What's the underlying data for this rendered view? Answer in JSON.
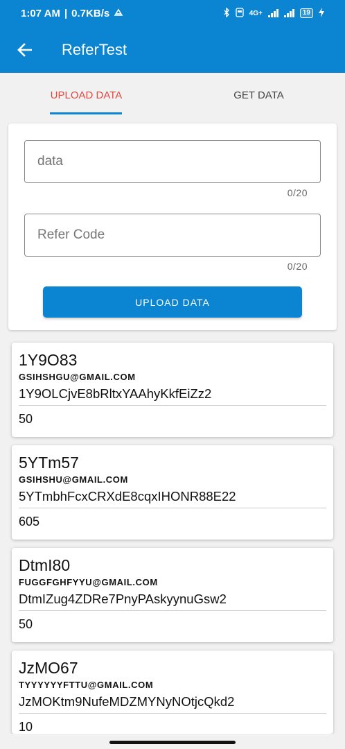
{
  "status_bar": {
    "time": "1:07 AM",
    "separator": "|",
    "speed": "0.7KB/s",
    "network": "4G+",
    "battery": "19"
  },
  "app_bar": {
    "title": "ReferTest"
  },
  "tabs": [
    {
      "label": "UPLOAD DATA",
      "active": true
    },
    {
      "label": "GET DATA",
      "active": false
    }
  ],
  "form": {
    "data_field": {
      "placeholder": "data",
      "counter": "0/20"
    },
    "refer_field": {
      "placeholder": "Refer Code",
      "counter": "0/20"
    },
    "button_label": "UPLOAD DATA"
  },
  "records": [
    {
      "code": "1Y9O83",
      "email": "GSIHSHGU@GMAIL.COM",
      "key": "1Y9OLCjvE8bRltxYAAhyKkfEiZz2",
      "count": "50"
    },
    {
      "code": "5YTm57",
      "email": "GSIHSHU@GMAIL.COM",
      "key": "5YTmbhFcxCRXdE8cqxIHONR88E22",
      "count": "605"
    },
    {
      "code": "DtmI80",
      "email": "FUGGFGHFYYU@GMAIL.COM",
      "key": "DtmIZug4ZDRe7PnyPAskyynuGsw2",
      "count": "50"
    },
    {
      "code": "JzMO67",
      "email": "TYYYYYYFTTU@GMAIL.COM",
      "key": "JzMOKtm9NufeMDZMYNyNOtjcQkd2",
      "count": "10"
    }
  ]
}
